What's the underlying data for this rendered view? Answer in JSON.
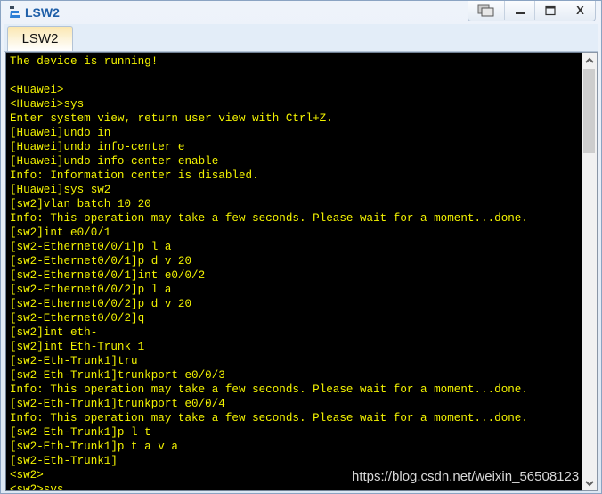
{
  "window": {
    "title": "LSW2",
    "app_icon": "ensp-device-icon",
    "controls": [
      {
        "name": "restore-layout-button",
        "icon": "cascade-windows-icon",
        "glyph": "⧉"
      },
      {
        "name": "minimize-button",
        "icon": "minimize-icon",
        "glyph": "—"
      },
      {
        "name": "maximize-button",
        "icon": "maximize-icon",
        "glyph": "▭"
      },
      {
        "name": "close-button",
        "icon": "close-icon",
        "glyph": "X"
      }
    ]
  },
  "tabs": [
    {
      "label": "LSW2",
      "active": true
    }
  ],
  "terminal": {
    "text_color": "#f3f300",
    "background": "#000000",
    "lines": [
      "The device is running!",
      "",
      "<Huawei>",
      "<Huawei>sys",
      "Enter system view, return user view with Ctrl+Z.",
      "[Huawei]undo in",
      "[Huawei]undo info-center e",
      "[Huawei]undo info-center enable",
      "Info: Information center is disabled.",
      "[Huawei]sys sw2",
      "[sw2]vlan batch 10 20",
      "Info: This operation may take a few seconds. Please wait for a moment...done.",
      "[sw2]int e0/0/1",
      "[sw2-Ethernet0/0/1]p l a",
      "[sw2-Ethernet0/0/1]p d v 20",
      "[sw2-Ethernet0/0/1]int e0/0/2",
      "[sw2-Ethernet0/0/2]p l a",
      "[sw2-Ethernet0/0/2]p d v 20",
      "[sw2-Ethernet0/0/2]q",
      "[sw2]int eth-",
      "[sw2]int Eth-Trunk 1",
      "[sw2-Eth-Trunk1]tru",
      "[sw2-Eth-Trunk1]trunkport e0/0/3",
      "Info: This operation may take a few seconds. Please wait for a moment...done.",
      "[sw2-Eth-Trunk1]trunkport e0/0/4",
      "Info: This operation may take a few seconds. Please wait for a moment...done.",
      "[sw2-Eth-Trunk1]p l t",
      "[sw2-Eth-Trunk1]p t a v a",
      "[sw2-Eth-Trunk1]",
      "<sw2>",
      "<sw2>sys"
    ]
  },
  "scrollbar": {
    "up_glyph": "⌃",
    "down_glyph": "⌄"
  },
  "watermark": "https://blog.csdn.net/weixin_56508123"
}
